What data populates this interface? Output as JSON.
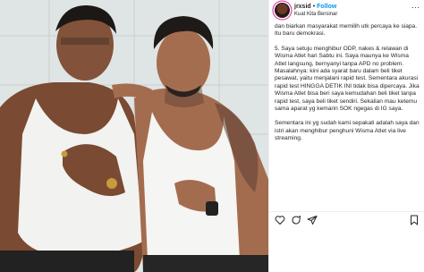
{
  "post": {
    "username": "jrxsid",
    "separator": "•",
    "follow_label": "Follow",
    "location": "Kuat Kita Bersinar",
    "more_label": "···",
    "caption_paragraphs": [
      "dan biarkan masyarakat memilih utk percaya ke siapa. Itu baru demokrasi.",
      "5. Saya setuju menghibur ODP, nakes & relawan di Wisma Atlet hari Sabtu ini. Saya maunya ke Wisma Atlet langsung, bernyanyi tanpa APD no problem. Masalahnya: kini ada syarat baru dalam beli tiket pesawat, yaitu menjalani rapid test. Sementara akurasi rapid test HINGGA DETIK INI tidak bisa dipercaya. Jika Wisma Atlet bisa beri saya kemudahan beli tiket tanpa rapid test, saya beli tiket sendiri. Sekalian mau ketemu sama aparat yg kemarin SOK ngegas di IG saya.",
      "Sementara ini yg sudah kami sepakati adalah saya dan istri akan menghibur penghuni Wisma Atlet via live streaming."
    ]
  },
  "icons": {
    "avatar": "profile-avatar",
    "like": "heart-icon",
    "comment": "comment-icon",
    "share": "paper-plane-icon",
    "save": "bookmark-icon"
  },
  "colors": {
    "follow_blue": "#0095f6",
    "text": "#262626",
    "avatar_ring": "#d6249f"
  }
}
